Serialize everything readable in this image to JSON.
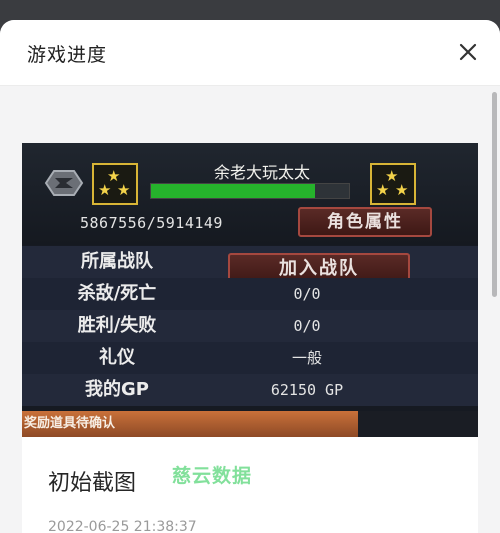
{
  "header": {
    "title": "游戏进度"
  },
  "screenshot": {
    "player_name": "余老大玩太太",
    "experience": "5867556/5914149",
    "experience_progress": 0.83,
    "attribute_button": "角色属性",
    "join_clan_button": "加入战队",
    "rows": [
      {
        "label": "所属战队",
        "value": ""
      },
      {
        "label": "杀敌/死亡",
        "value": "0/0"
      },
      {
        "label": "胜利/失败",
        "value": "0/0"
      },
      {
        "label": "礼仪",
        "value": "一般"
      },
      {
        "label": "我的GP",
        "value": "62150 GP"
      }
    ],
    "reward_banner": "奖励道具待确认"
  },
  "card": {
    "title": "初始截图",
    "watermark": "慈云数据",
    "timestamp": "2022-06-25 21:38:37"
  },
  "icons": {
    "close": "close-icon",
    "emblem": "game-emblem-icon",
    "rank": "rank-stars-icon"
  },
  "colors": {
    "progress": "#26b32c",
    "button_border": "#a5483f",
    "rank_gold": "#d8b536"
  }
}
